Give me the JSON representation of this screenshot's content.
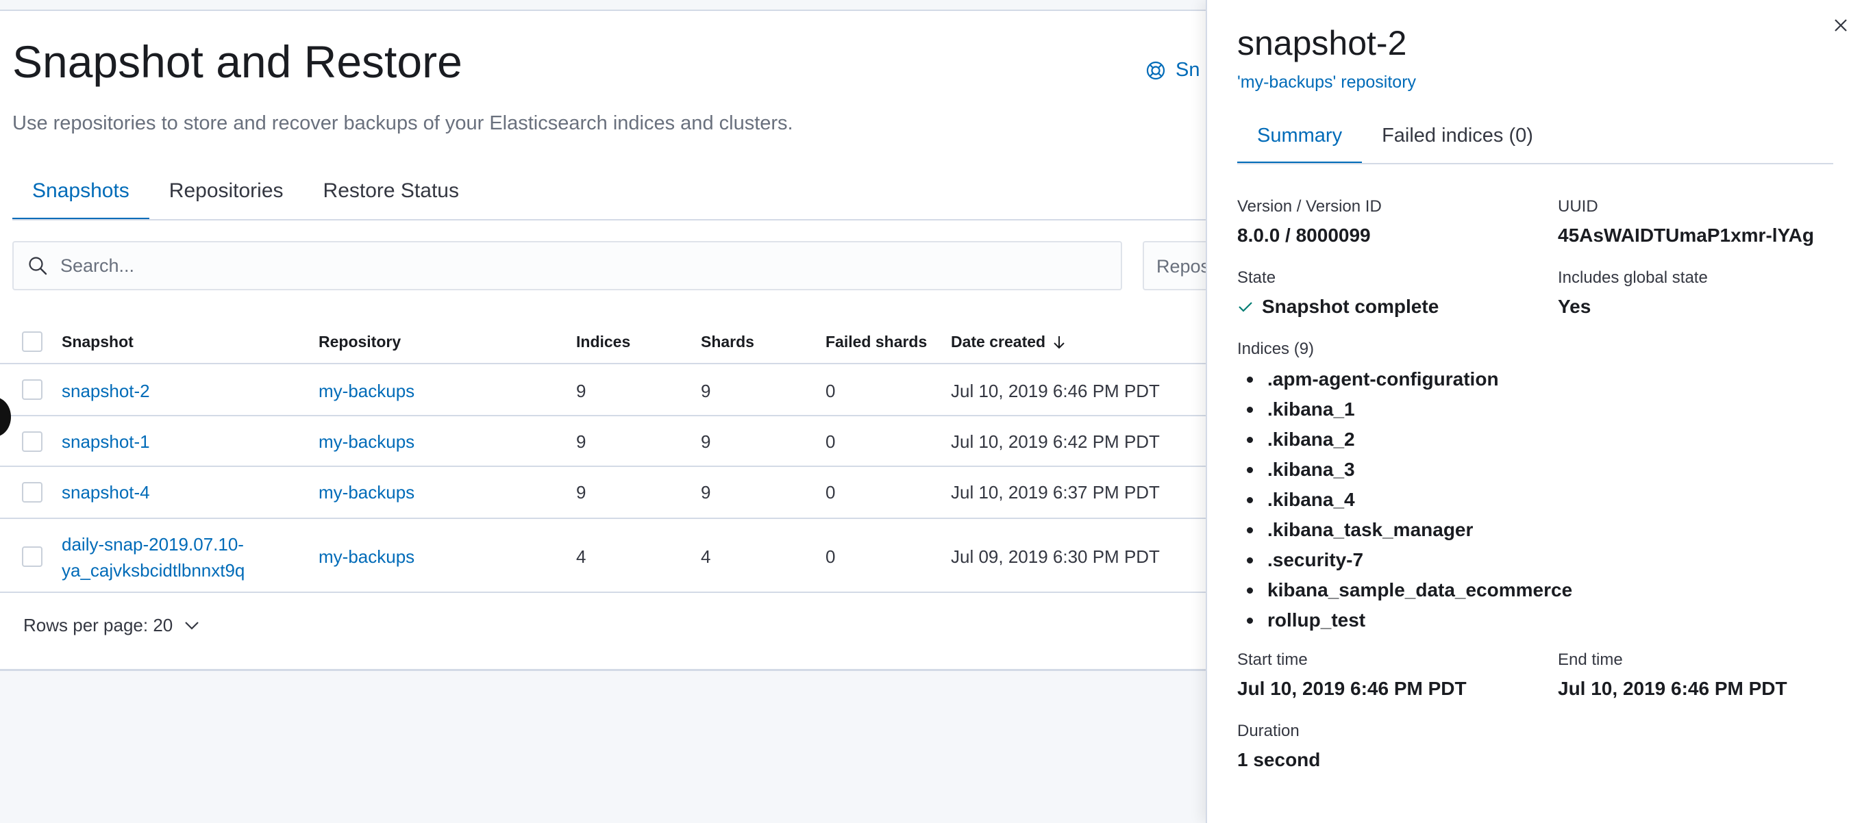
{
  "page": {
    "title": "Snapshot and Restore",
    "description": "Use repositories to store and recover backups of your Elasticsearch indices and clusters.",
    "docs_link": "Sn"
  },
  "tabs": [
    {
      "label": "Snapshots",
      "active": true
    },
    {
      "label": "Repositories",
      "active": false
    },
    {
      "label": "Restore Status",
      "active": false
    }
  ],
  "search": {
    "placeholder": "Search..."
  },
  "repo_filter": {
    "label": "Repos"
  },
  "table": {
    "headers": {
      "snapshot": "Snapshot",
      "repository": "Repository",
      "indices": "Indices",
      "shards": "Shards",
      "failed_shards": "Failed shards",
      "date_created": "Date created"
    },
    "rows": [
      {
        "snapshot": "snapshot-2",
        "repository": "my-backups",
        "indices": "9",
        "shards": "9",
        "failed_shards": "0",
        "date_created": "Jul 10, 2019 6:46 PM PDT"
      },
      {
        "snapshot": "snapshot-1",
        "repository": "my-backups",
        "indices": "9",
        "shards": "9",
        "failed_shards": "0",
        "date_created": "Jul 10, 2019 6:42 PM PDT"
      },
      {
        "snapshot": "snapshot-4",
        "repository": "my-backups",
        "indices": "9",
        "shards": "9",
        "failed_shards": "0",
        "date_created": "Jul 10, 2019 6:37 PM PDT"
      },
      {
        "snapshot_line1": "daily-snap-2019.07.10-",
        "snapshot_line2": "ya_cajvksbcidtlbnnxt9q",
        "repository": "my-backups",
        "indices": "4",
        "shards": "4",
        "failed_shards": "0",
        "date_created": "Jul 09, 2019 6:30 PM PDT"
      }
    ]
  },
  "pagination": {
    "rows_per_page": "Rows per page: 20"
  },
  "flyout": {
    "title": "snapshot-2",
    "subtitle": "'my-backups' repository",
    "tabs": [
      {
        "label": "Summary",
        "active": true
      },
      {
        "label": "Failed indices (0)",
        "active": false
      }
    ],
    "version_label": "Version / Version ID",
    "version_value": "8.0.0 / 8000099",
    "uuid_label": "UUID",
    "uuid_value": "45AsWAIDTUmaP1xmr-lYAg",
    "state_label": "State",
    "state_value": "Snapshot complete",
    "global_state_label": "Includes global state",
    "global_state_value": "Yes",
    "indices_label": "Indices (9)",
    "indices": [
      ".apm-agent-configuration",
      ".kibana_1",
      ".kibana_2",
      ".kibana_3",
      ".kibana_4",
      ".kibana_task_manager",
      ".security-7",
      "kibana_sample_data_ecommerce",
      "rollup_test"
    ],
    "start_time_label": "Start time",
    "start_time_value": "Jul 10, 2019 6:46 PM PDT",
    "end_time_label": "End time",
    "end_time_value": "Jul 10, 2019 6:46 PM PDT",
    "duration_label": "Duration",
    "duration_value": "1 second"
  },
  "colors": {
    "accent": "#006bb8",
    "text": "#343741",
    "heading": "#1a1c21",
    "border": "#d3dae6",
    "success": "#017d73"
  },
  "icons": [
    "help-icon",
    "search-icon",
    "sort-down-icon",
    "chevron-down-icon",
    "close-icon",
    "check-icon"
  ]
}
